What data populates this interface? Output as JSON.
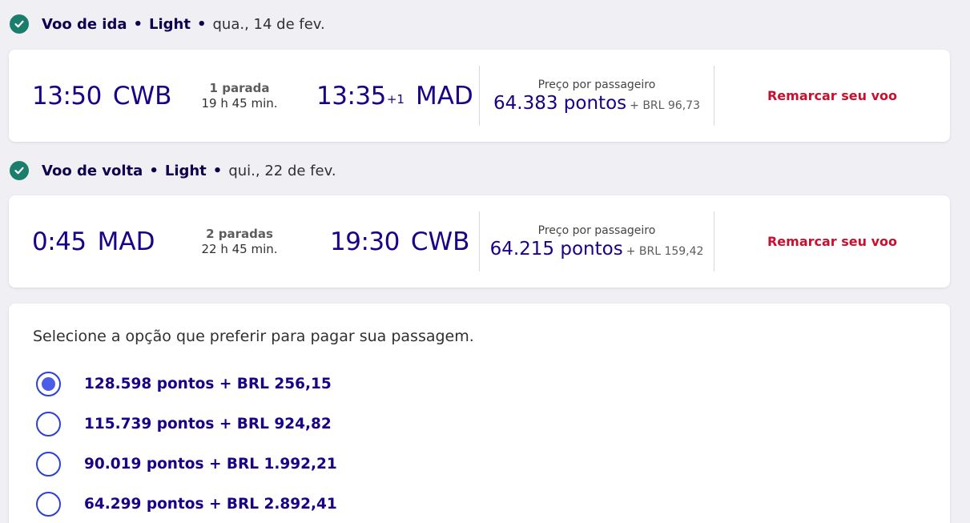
{
  "outbound": {
    "header": {
      "title": "Voo de ida",
      "fare": "Light",
      "date": "qua., 14 de fev."
    },
    "departure_time": "13:50",
    "departure_airport": "CWB",
    "stops": "1 parada",
    "duration": "19 h 45 min.",
    "arrival_time": "13:35",
    "day_offset": "+1",
    "arrival_airport": "MAD",
    "price_label": "Preço por passageiro",
    "points": "64.383 pontos",
    "brl": "+ BRL 96,73",
    "action": "Remarcar seu voo"
  },
  "return": {
    "header": {
      "title": "Voo de volta",
      "fare": "Light",
      "date": "qui., 22 de fev."
    },
    "departure_time": "0:45",
    "departure_airport": "MAD",
    "stops": "2 paradas",
    "duration": "22 h 45 min.",
    "arrival_time": "19:30",
    "arrival_airport": "CWB",
    "price_label": "Preço por passageiro",
    "points": "64.215 pontos",
    "brl": "+ BRL 159,42",
    "action": "Remarcar seu voo"
  },
  "payment": {
    "title": "Selecione a opção que preferir para pagar sua passagem.",
    "options": [
      {
        "label": "128.598 pontos + BRL 256,15",
        "selected": true
      },
      {
        "label": "115.739 pontos + BRL 924,82",
        "selected": false
      },
      {
        "label": "90.019 pontos + BRL 1.992,21",
        "selected": false
      },
      {
        "label": "64.299 pontos + BRL 2.892,41",
        "selected": false
      }
    ]
  },
  "colors": {
    "primary": "#1b0088",
    "check": "#1b7d6c",
    "action": "#c8102e",
    "radio": "#2e3fd6"
  },
  "icons": {
    "confirmed": "check-circle-icon",
    "radio": "radio-button-icon"
  }
}
